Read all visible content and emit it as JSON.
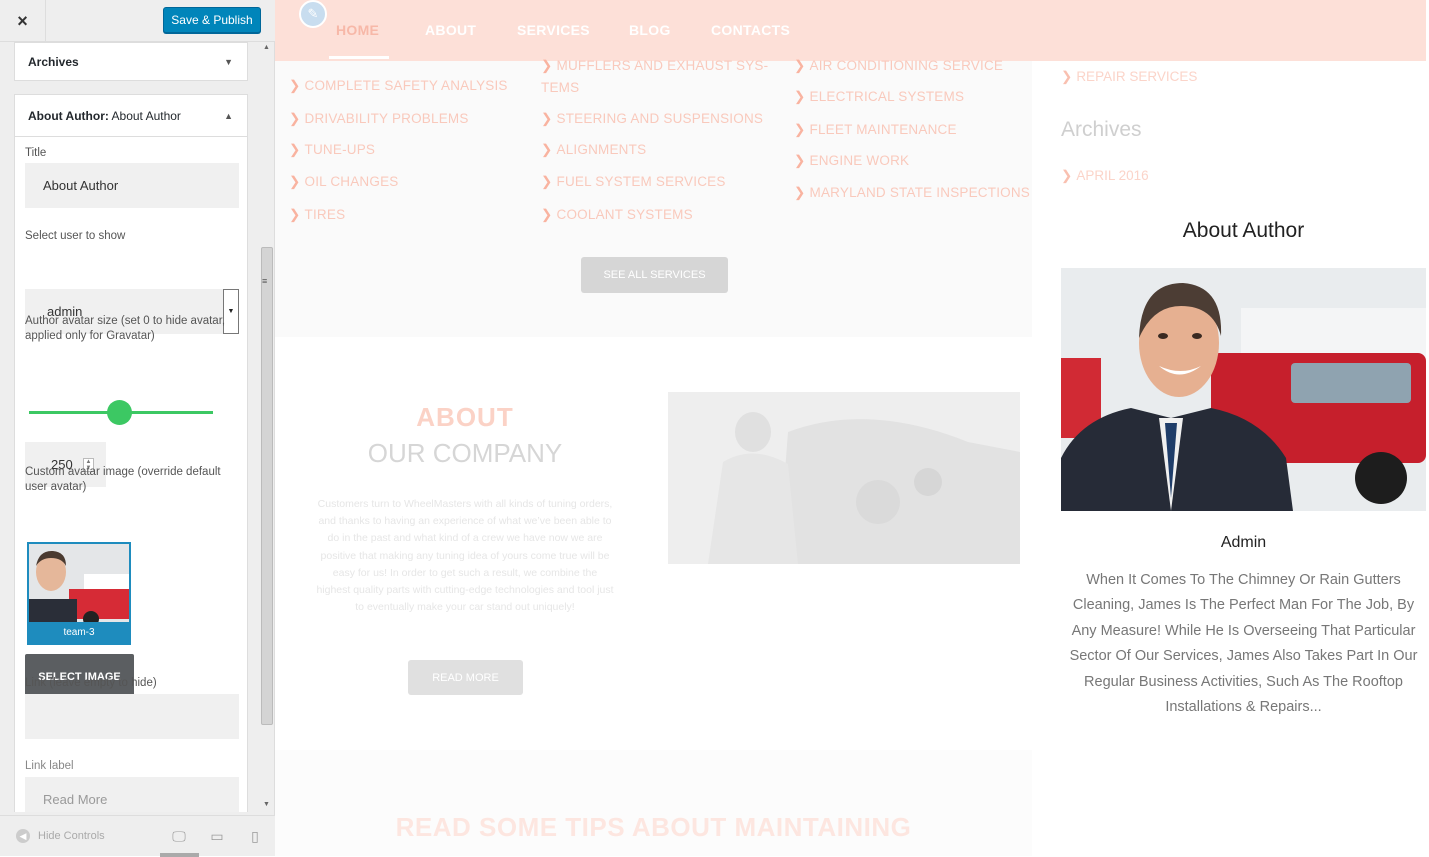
{
  "panel": {
    "close_icon": "×",
    "save_label": "Save & Publish",
    "archives_section": "Archives",
    "widget_title_bold": "About Author:",
    "widget_title_rest": " About Author",
    "fields": {
      "title_label": "Title",
      "title_value": "About Author",
      "user_label": "Select user to show",
      "user_value": "admin",
      "avatar_size_label": "Author avatar size (set 0 to hide avatar, applied only for Gravatar)",
      "avatar_size_value": "250",
      "custom_avatar_label": "Custom avatar image (override default user avatar)",
      "avatar_filename": "team-3",
      "select_image_label": "SELECT IMAGE",
      "link_label": "Link (leave empty to hide)",
      "link_value": "",
      "link_text_label": "Link label",
      "link_text_placeholder": "Read More"
    },
    "slider_fraction": 0.49,
    "footer": {
      "hide_controls": "Hide Controls",
      "devices": [
        "desktop-icon",
        "tablet-icon",
        "mobile-icon"
      ]
    }
  },
  "preview": {
    "nav": [
      "HOME",
      "ABOUT",
      "SERVICES",
      "BLOG",
      "CONTACTS"
    ],
    "services_col1": [
      "COMPLETE SAFETY ANALYSIS",
      "DRIVABILITY PROBLEMS",
      "TUNE-UPS",
      "OIL CHANGES",
      "TIRES"
    ],
    "services_col2_line1": "MUFFLERS AND EXHAUST SYS-",
    "services_col2_line2": "TEMS",
    "services_col2": [
      "STEERING AND SUSPENSIONS",
      "ALIGNMENTS",
      "FUEL SYSTEM SERVICES",
      "COOLANT SYSTEMS"
    ],
    "services_col3": [
      "AIR CONDITIONING SERVICE",
      "ELECTRICAL SYSTEMS",
      "FLEET MAINTENANCE",
      "ENGINE WORK",
      "MARYLAND STATE INSPECTIONS"
    ],
    "see_all": "SEE ALL SERVICES",
    "about_title": "ABOUT",
    "about_sub": "OUR COMPANY",
    "about_text": "Customers turn to WheelMasters with all kinds of tuning orders, and thanks to having an experience of what we’ve been able to do in the past and what kind of a crew we have now we are positive that making any tuning idea of yours come true will be easy for us! In order to get such a result, we combine the highest quality parts with cutting-edge technologies and tool just to eventually make your car stand out uniquely!",
    "read_more": "READ MORE",
    "tips_title": "READ SOME TIPS ABOUT MAINTAINING",
    "sidebar": {
      "repair_link": "REPAIR SERVICES",
      "archives_title": "Archives",
      "archive_item": "APRIL 2016",
      "author_heading": "About Author",
      "author_name": "Admin",
      "author_bio": "When It Comes To The Chimney Or Rain Gutters Cleaning, James Is The Perfect Man For The Job, By Any Measure! While He Is Overseeing That Particular Sector Of Our Services, James Also Takes Part In Our Regular Business Activities, Such As The Rooftop Installations & Repairs..."
    }
  },
  "colors": {
    "accent_blue": "#0085ba",
    "slider_green": "#3cc863",
    "header_peach": "#fde0d8"
  }
}
